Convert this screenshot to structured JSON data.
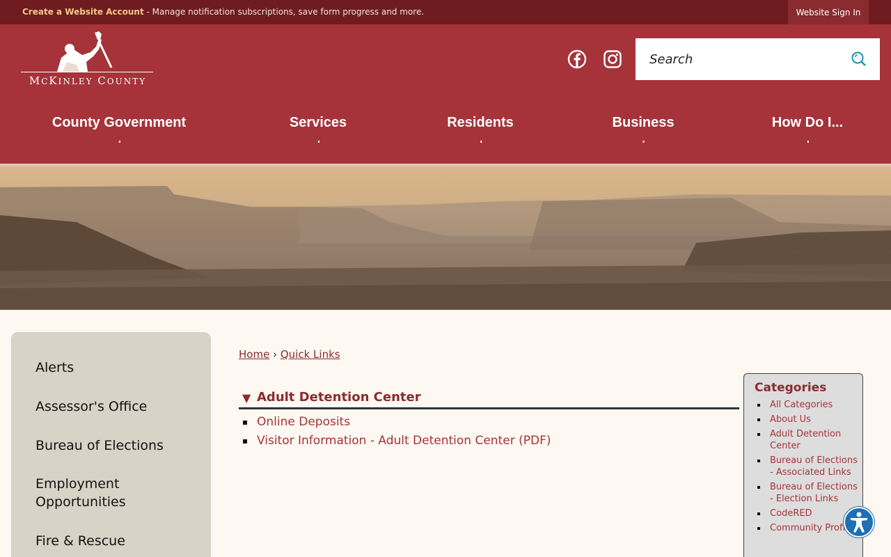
{
  "topbar": {
    "account_link": "Create a Website Account",
    "account_desc": " - Manage notification subscriptions, save form progress and more.",
    "signin_label": "Website Sign In"
  },
  "header": {
    "logo_text": "McKinley County",
    "search_placeholder": "Search",
    "social": [
      "facebook-icon",
      "instagram-icon"
    ],
    "brand_color": "#a6333a"
  },
  "nav": {
    "items": [
      {
        "label": "County Government"
      },
      {
        "label": "Services"
      },
      {
        "label": "Residents"
      },
      {
        "label": "Business"
      },
      {
        "label": "How Do I..."
      }
    ]
  },
  "sidebar": {
    "items": [
      {
        "label": "Alerts"
      },
      {
        "label": "Assessor's Office"
      },
      {
        "label": "Bureau of Elections"
      },
      {
        "label": "Employment Opportunities"
      },
      {
        "label": "Fire & Rescue"
      }
    ]
  },
  "breadcrumb": {
    "home": "Home",
    "separator": "›",
    "current": "Quick Links"
  },
  "section": {
    "toggle": "▼",
    "title": "Adult Detention Center",
    "links": [
      {
        "label": "Online Deposits"
      },
      {
        "label": "Visitor Information - Adult Detention Center (PDF)"
      }
    ]
  },
  "categories": {
    "title": "Categories",
    "items": [
      {
        "label": "All Categories"
      },
      {
        "label": "About Us"
      },
      {
        "label": "Adult Detention Center"
      },
      {
        "label": "Bureau of Elections - Associated Links"
      },
      {
        "label": "Bureau of Elections - Election Links"
      },
      {
        "label": "CodeRED"
      },
      {
        "label": "Community Profile"
      }
    ]
  }
}
